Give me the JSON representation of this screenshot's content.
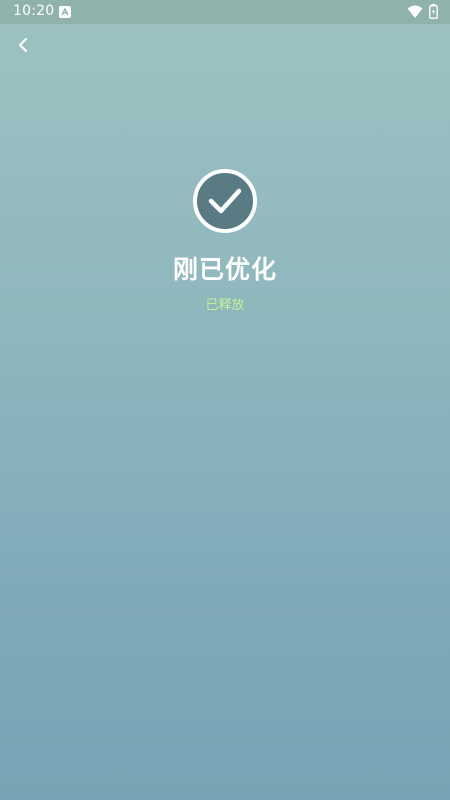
{
  "status_bar": {
    "time": "10:20",
    "icons": [
      "a-icon",
      "wifi-icon",
      "battery-icon"
    ]
  },
  "nav": {
    "back_icon": "chevron-left-icon"
  },
  "result": {
    "icon": "check-circle-icon",
    "title": "刚已优化",
    "subtitle": "已释放"
  },
  "colors": {
    "background_top": "#9dc2c1",
    "background_bottom": "#77a3b4",
    "check_fill": "#587b84",
    "subtitle": "#c7ef9a"
  }
}
